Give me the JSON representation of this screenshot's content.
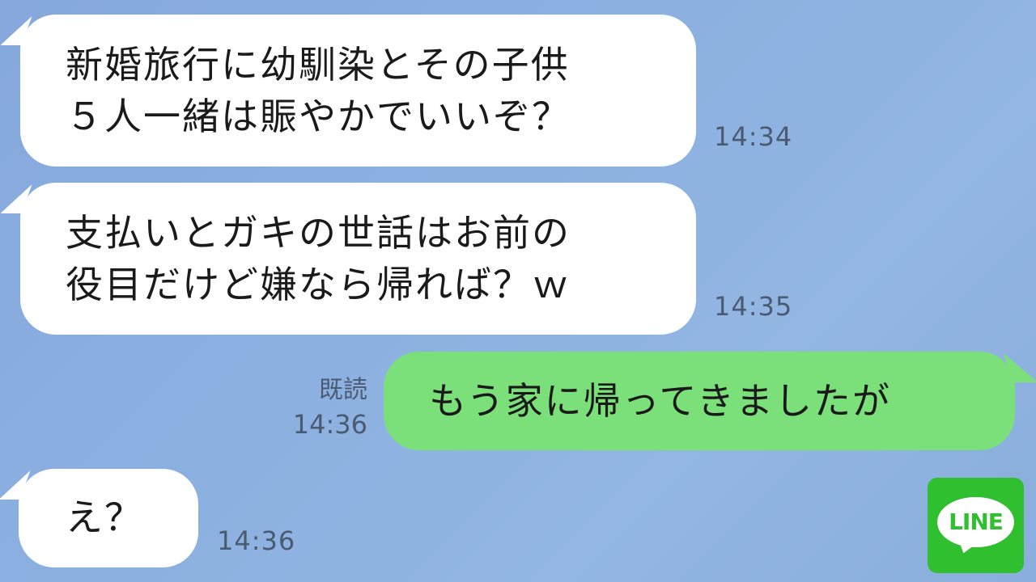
{
  "messages": [
    {
      "side": "in",
      "text": "新婚旅行に幼馴染とその子供\n５人一緒は賑やかでいいぞ？",
      "time": "14:34"
    },
    {
      "side": "in",
      "text": "支払いとガキの世話はお前の\n役目だけど嫌なら帰れば？ｗ",
      "time": "14:35"
    },
    {
      "side": "out",
      "text": "もう家に帰ってきましたが",
      "read": "既読",
      "time": "14:36"
    },
    {
      "side": "in",
      "text": "え？",
      "time": "14:36"
    }
  ],
  "logo": {
    "text": "LINE",
    "color": "#2fbf2f"
  },
  "colors": {
    "background": "#8bb0e0",
    "incoming_bubble": "#ffffff",
    "outgoing_bubble": "#7ce07a"
  }
}
